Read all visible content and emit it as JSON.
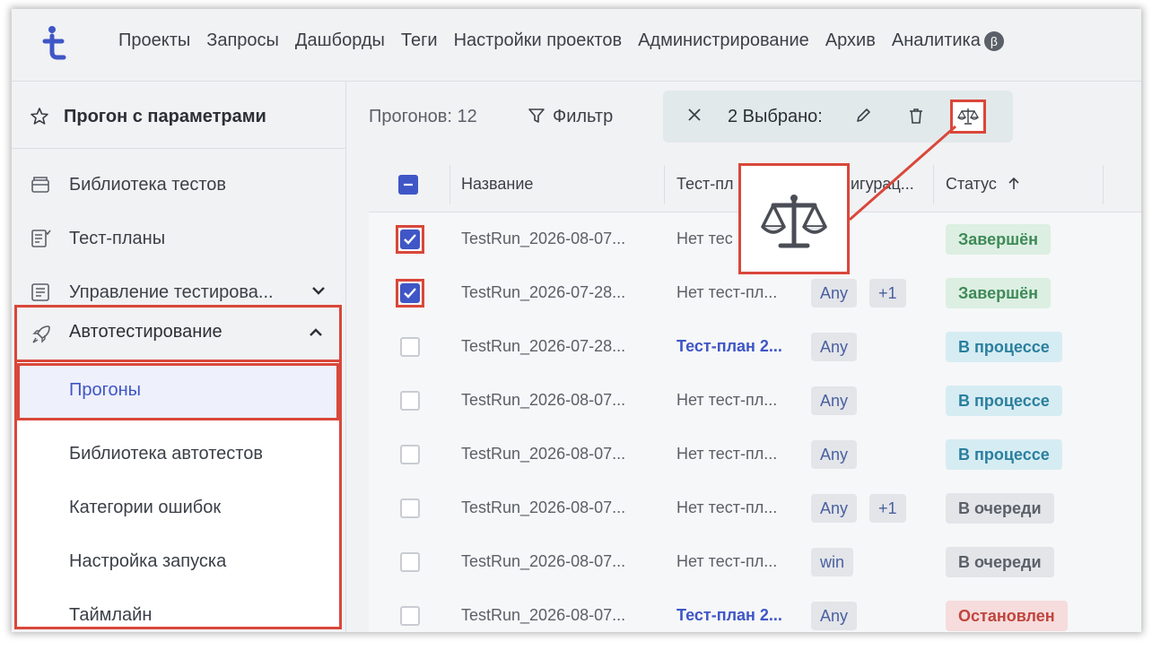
{
  "nav": {
    "items": [
      "Проекты",
      "Запросы",
      "Дашборды",
      "Теги",
      "Настройки проектов",
      "Администрирование",
      "Архив",
      "Аналитика"
    ],
    "beta_badge": "β"
  },
  "sidebar": {
    "title": "Прогон с параметрами",
    "items": [
      {
        "label": "Библиотека тестов",
        "icon": "library-icon"
      },
      {
        "label": "Тест-планы",
        "icon": "test-plan-icon"
      },
      {
        "label": "Управление тестирова...",
        "icon": "management-icon"
      },
      {
        "label": "Автотестирование",
        "icon": "rocket-icon"
      }
    ],
    "sub_items": [
      "Прогоны",
      "Библиотека автотестов",
      "Категории ошибок",
      "Настройка запуска",
      "Таймлайн"
    ]
  },
  "toolbar": {
    "count_label": "Прогонов: 12",
    "filter_label": "Фильтр",
    "selected_label": "2 Выбрано:"
  },
  "table": {
    "headers": [
      "Название",
      "Тест-пл",
      "игурац...",
      "Статус"
    ],
    "rows": [
      {
        "name": "TestRun_2026-08-07...",
        "plan": "Нет тес",
        "plan_link": false,
        "tags": [],
        "status": "Завершён",
        "status_type": "done",
        "checked": true
      },
      {
        "name": "TestRun_2026-07-28...",
        "plan": "Нет тест-пл...",
        "plan_link": false,
        "tags": [
          "Any",
          "+1"
        ],
        "status": "Завершён",
        "status_type": "done",
        "checked": true
      },
      {
        "name": "TestRun_2026-07-28...",
        "plan": "Тест-план 2...",
        "plan_link": true,
        "tags": [
          "Any"
        ],
        "status": "В процессе",
        "status_type": "progress",
        "checked": false
      },
      {
        "name": "TestRun_2026-08-07...",
        "plan": "Нет тест-пл...",
        "plan_link": false,
        "tags": [
          "Any"
        ],
        "status": "В процессе",
        "status_type": "progress",
        "checked": false
      },
      {
        "name": "TestRun_2026-08-07...",
        "plan": "Нет тест-пл...",
        "plan_link": false,
        "tags": [
          "Any"
        ],
        "status": "В процессе",
        "status_type": "progress",
        "checked": false
      },
      {
        "name": "TestRun_2026-08-07...",
        "plan": "Нет тест-пл...",
        "plan_link": false,
        "tags": [
          "Any",
          "+1"
        ],
        "status": "В очереди",
        "status_type": "queue",
        "checked": false
      },
      {
        "name": "TestRun_2026-08-07...",
        "plan": "Нет тест-пл...",
        "plan_link": false,
        "tags": [
          "win"
        ],
        "status": "В очереди",
        "status_type": "queue",
        "checked": false
      },
      {
        "name": "TestRun_2026-08-07...",
        "plan": "Тест-план 2...",
        "plan_link": true,
        "tags": [
          "Any"
        ],
        "status": "Остановлен",
        "status_type": "stopped",
        "checked": false
      }
    ]
  },
  "colors": {
    "accent": "#3f56c6",
    "highlight": "#d9473a",
    "done_bg": "#dcefe2",
    "done_fg": "#3f8a58",
    "progress_bg": "#d6ecf3",
    "progress_fg": "#2a7f9e",
    "queue_bg": "#e3e5e9",
    "queue_fg": "#5b6068",
    "stopped_bg": "#f6dcdc",
    "stopped_fg": "#c0453e"
  }
}
